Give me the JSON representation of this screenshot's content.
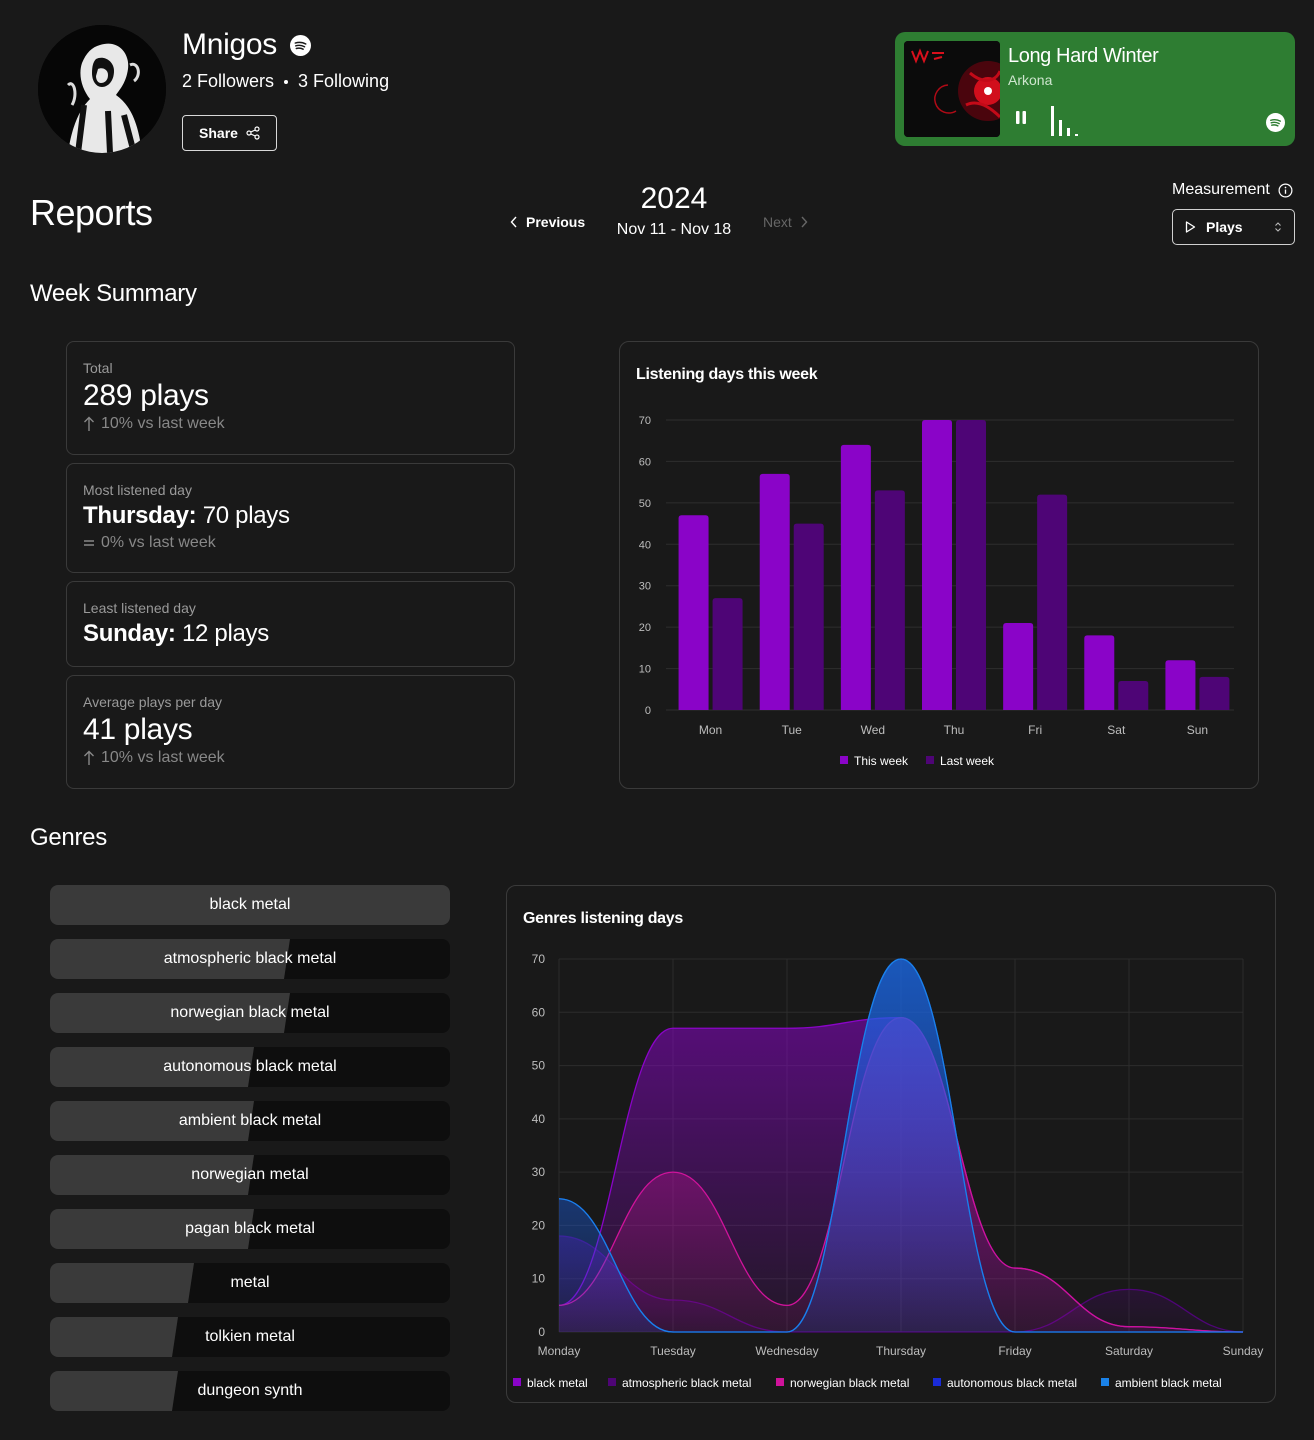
{
  "profile": {
    "name": "Mnigos",
    "followers": "2 Followers",
    "following": "3 Following",
    "share_label": "Share"
  },
  "now_playing": {
    "title": "Long Hard Winter",
    "artist": "Arkona",
    "bg_color": "#2e7d32"
  },
  "reports": {
    "title": "Reports",
    "year": "2024",
    "range": "Nov 11 - Nov 18",
    "previous_label": "Previous",
    "next_label": "Next",
    "measurement_label": "Measurement",
    "measurement_value": "Plays"
  },
  "week_summary": {
    "title": "Week Summary",
    "total": {
      "caption": "Total",
      "value": "289 plays",
      "change": "10% vs last week"
    },
    "most": {
      "caption": "Most listened day",
      "day": "Thursday:",
      "value": " 70 plays",
      "change": "0% vs last week"
    },
    "least": {
      "caption": "Least listened day",
      "day": "Sunday:",
      "value": " 12 plays"
    },
    "average": {
      "caption": "Average plays per day",
      "value": "41 plays",
      "change": "10% vs last week"
    }
  },
  "genres": {
    "title": "Genres",
    "items": [
      {
        "label": "black metal",
        "fill": 1.0
      },
      {
        "label": "atmospheric black metal",
        "fill": 0.6
      },
      {
        "label": "norwegian black metal",
        "fill": 0.6
      },
      {
        "label": "autonomous black metal",
        "fill": 0.51
      },
      {
        "label": "ambient black metal",
        "fill": 0.51
      },
      {
        "label": "norwegian metal",
        "fill": 0.51
      },
      {
        "label": "pagan black metal",
        "fill": 0.51
      },
      {
        "label": "metal",
        "fill": 0.36
      },
      {
        "label": "tolkien metal",
        "fill": 0.32
      },
      {
        "label": "dungeon synth",
        "fill": 0.32
      }
    ]
  },
  "chart_data": [
    {
      "type": "bar",
      "title": "Listening days this week",
      "categories": [
        "Mon",
        "Tue",
        "Wed",
        "Thu",
        "Fri",
        "Sat",
        "Sun"
      ],
      "ylim": [
        0,
        70
      ],
      "yticks": [
        0,
        10,
        20,
        30,
        40,
        50,
        60,
        70
      ],
      "series": [
        {
          "name": "This week",
          "color": "#8a04c8",
          "values": [
            47,
            57,
            64,
            70,
            21,
            18,
            12
          ]
        },
        {
          "name": "Last week",
          "color": "#4e0576",
          "values": [
            27,
            45,
            53,
            70,
            52,
            7,
            8
          ]
        }
      ],
      "legend": "bottom"
    },
    {
      "type": "area",
      "title": "Genres listening days",
      "categories": [
        "Monday",
        "Tuesday",
        "Wednesday",
        "Thursday",
        "Friday",
        "Saturday",
        "Sunday"
      ],
      "ylim": [
        0,
        70
      ],
      "yticks": [
        0,
        10,
        20,
        30,
        40,
        50,
        60,
        70
      ],
      "grid": true,
      "series": [
        {
          "name": "black metal",
          "color": "#8a04c8",
          "values": [
            5,
            57,
            57,
            59,
            12,
            1,
            0
          ]
        },
        {
          "name": "atmospheric black metal",
          "color": "#4e0576",
          "values": [
            18,
            6,
            0,
            0,
            0,
            8,
            0
          ]
        },
        {
          "name": "norwegian black metal",
          "color": "#d0139b",
          "values": [
            5,
            30,
            5,
            59,
            12,
            1,
            0
          ]
        },
        {
          "name": "autonomous black metal",
          "color": "#1a2bd8",
          "values": [
            25,
            0,
            0,
            70,
            0,
            0,
            0
          ]
        },
        {
          "name": "ambient black metal",
          "color": "#1a82e8",
          "values": [
            25,
            0,
            0,
            70,
            0,
            0,
            0
          ]
        }
      ],
      "legend": "bottom"
    }
  ]
}
